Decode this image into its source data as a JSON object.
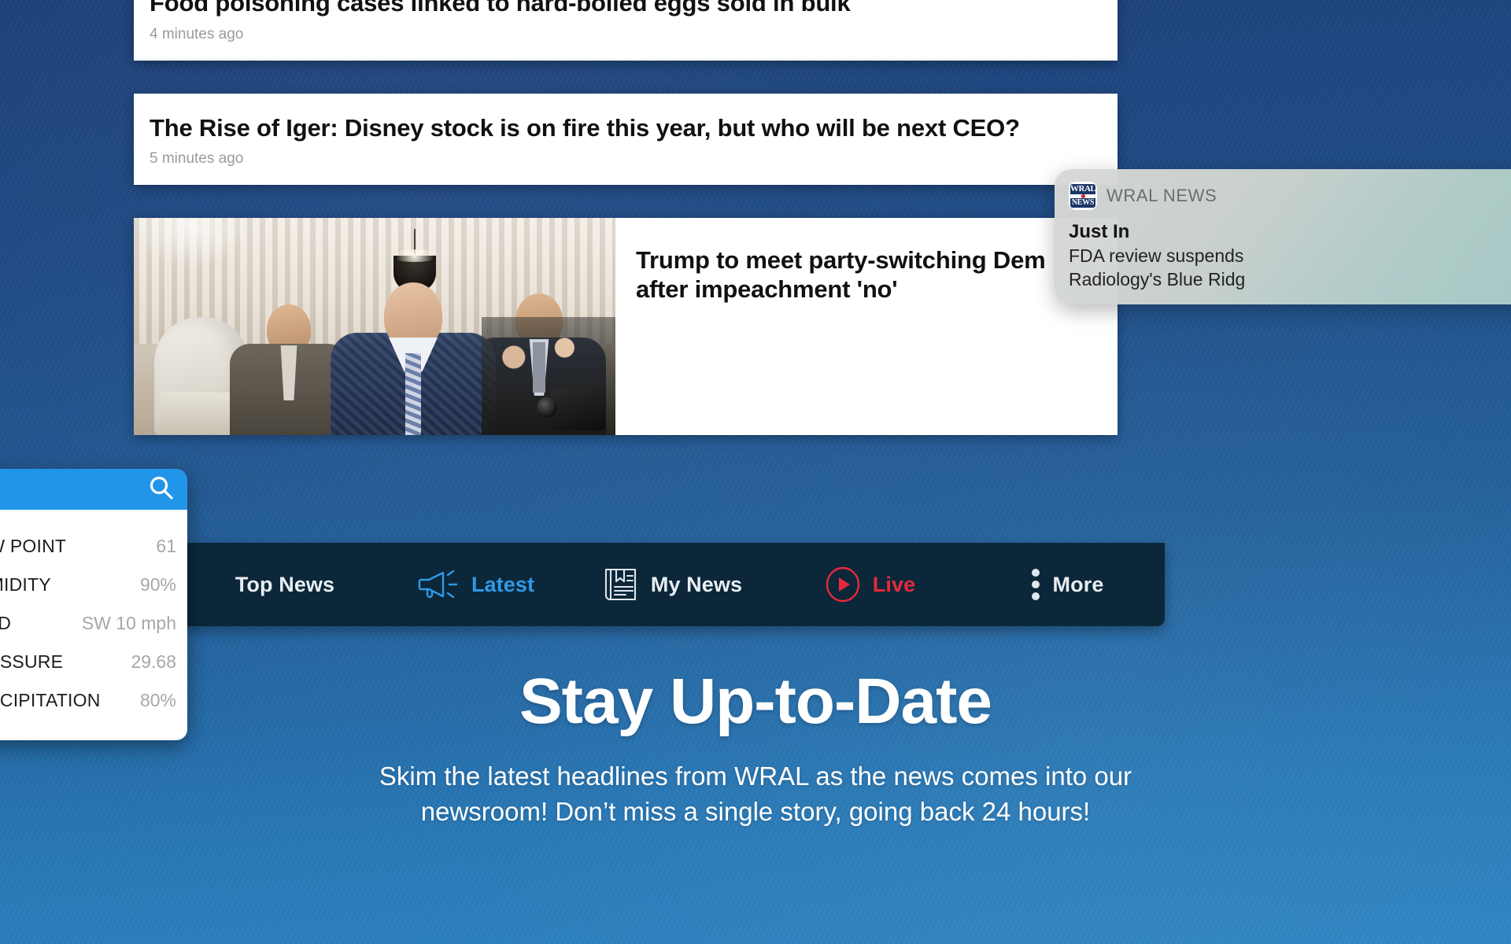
{
  "background": {
    "color_top": "#1b3f78",
    "color_bottom": "#2d86c4"
  },
  "stories": [
    {
      "headline": "Food poisoning cases linked to hard-boiled eggs sold in bulk",
      "timestamp": "4 minutes ago"
    },
    {
      "headline": "The Rise of Iger: Disney stock is on fire this year, but who will be next CEO?",
      "timestamp": "5 minutes ago"
    },
    {
      "headline": "Trump to meet party-switching Dem after impeachment 'no'",
      "timestamp": ""
    }
  ],
  "tab_bar": {
    "accent_active": "#2f9ae8",
    "accent_live": "#e8293c",
    "background": "#0b2739",
    "items": [
      {
        "label": "Top News",
        "icon": "star-icon",
        "state": "default"
      },
      {
        "label": "Latest",
        "icon": "megaphone-icon",
        "state": "active"
      },
      {
        "label": "My News",
        "icon": "newspaper-icon",
        "state": "default"
      },
      {
        "label": "Live",
        "icon": "play-circle-icon",
        "state": "live"
      },
      {
        "label": "More",
        "icon": "three-dots-vertical-icon",
        "state": "default"
      }
    ]
  },
  "weather_widget": {
    "search_icon": "search-icon",
    "header_color": "#2196e8",
    "rows": [
      {
        "key": "DEW POINT",
        "value": "61"
      },
      {
        "key": "HUMIDITY",
        "value": "90%"
      },
      {
        "key": "WIND",
        "value": "SW 10 mph"
      },
      {
        "key": "PRESSURE",
        "value": "29.68"
      },
      {
        "key": "PRECIPITATION",
        "value": "80%"
      }
    ]
  },
  "notification": {
    "app_icon": "wral-news-app-icon",
    "logo_top": "WRAL",
    "logo_bottom": "NEWS",
    "app_name": "WRAL NEWS",
    "title": "Just In",
    "body_line_1": "FDA review suspends",
    "body_line_2": "Radiology's Blue Ridg"
  },
  "hero": {
    "title": "Stay Up-to-Date",
    "subtitle_line_1": "Skim the latest headlines from WRAL as the news comes into our",
    "subtitle_line_2": "newsroom! Don’t miss a single story, going back 24 hours!"
  }
}
